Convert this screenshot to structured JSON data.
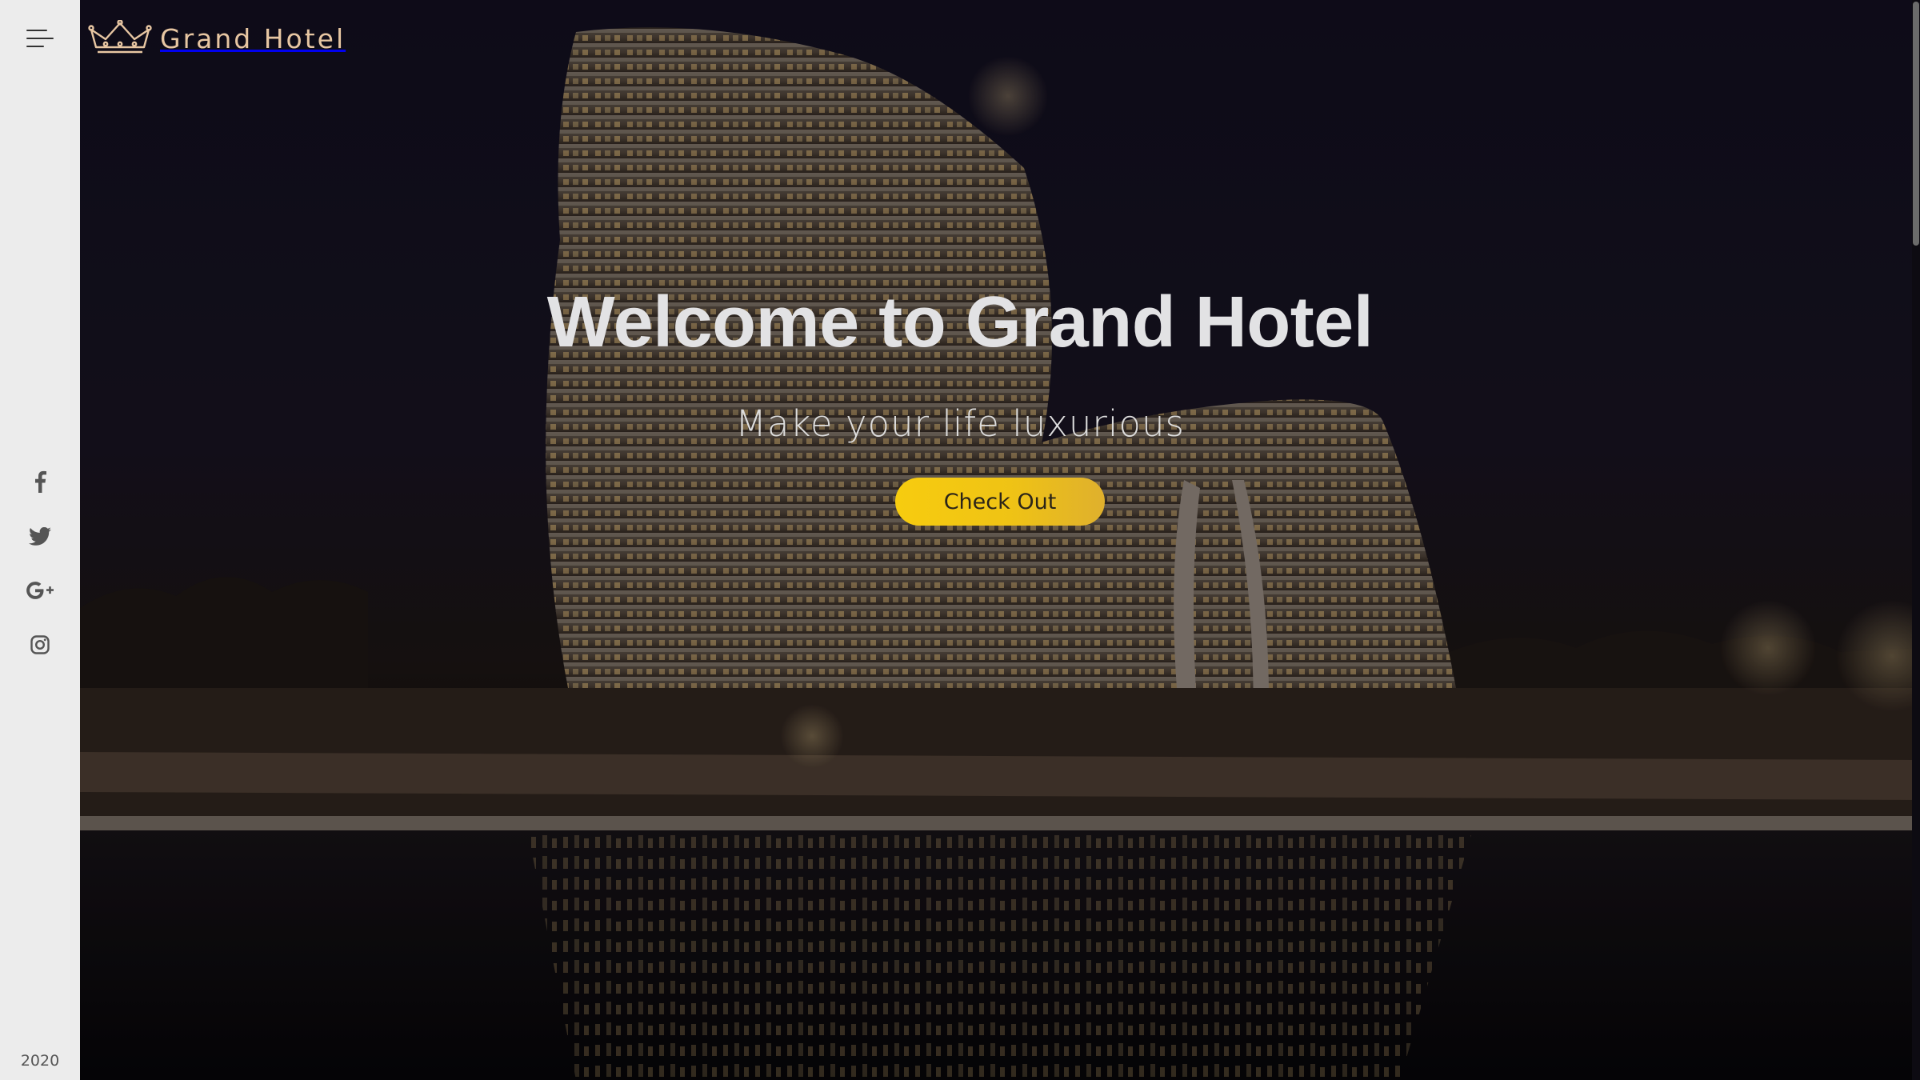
{
  "sidebar": {
    "menu_icon": "hamburger-menu-icon",
    "social": [
      {
        "name": "facebook",
        "icon": "facebook-icon"
      },
      {
        "name": "twitter",
        "icon": "twitter-icon"
      },
      {
        "name": "google-plus",
        "icon": "google-plus-icon"
      },
      {
        "name": "instagram",
        "icon": "instagram-icon"
      }
    ],
    "year": "2020"
  },
  "brand": {
    "logo_icon": "crown-icon",
    "title": "Grand Hotel"
  },
  "hero": {
    "title": "Welcome to Grand Hotel",
    "subtitle": "Make your life luxurious",
    "cta_label": "Check Out",
    "background_image": "hotel-night-photo"
  },
  "colors": {
    "brand_text": "#e7c6a2",
    "cta_gradient_start": "#f7cc0f",
    "cta_gradient_end": "#dfb02d",
    "sidebar_bg": "#ececec"
  }
}
